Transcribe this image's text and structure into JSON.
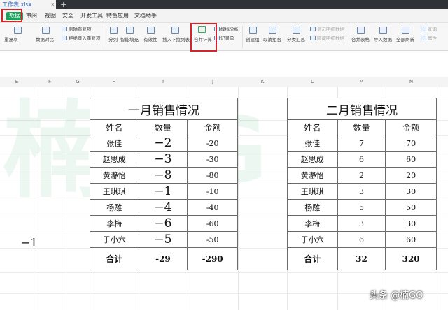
{
  "app": {
    "file_tab": "工作表.xlsx",
    "tab_close": "×",
    "add_tab": "+"
  },
  "menu": [
    "数据",
    "审阅",
    "视图",
    "安全",
    "开发工具",
    "特色应用",
    "文档助手"
  ],
  "menu_active_index": 0,
  "ribbon": {
    "dup_items": "重复项",
    "data_compare": "数据对比",
    "delete_dup": "删除重复项",
    "reject_dup": "拒绝录入重复项",
    "split": "分列",
    "smart_fill": "智能填充",
    "validity": "有效性",
    "insert_dropdown": "插入下拉列表",
    "consolidate": "合并计算",
    "simulate": "模拟分析",
    "record_sheet": "记录单",
    "group": "创建组",
    "ungroup": "取消组合",
    "subtotal": "分类汇总",
    "show_detail": "显示明细数据",
    "hide_detail": "隐藏明细数据",
    "merge_sheets": "合并表格",
    "import_data": "导入数据",
    "refresh_all": "全部刷新",
    "query": "查询",
    "properties": "属性"
  },
  "columns": [
    "E",
    "F",
    "G",
    "H",
    "I",
    "J",
    "K",
    "L",
    "M",
    "N"
  ],
  "table_jan": {
    "title": "一月销售情况",
    "headers": [
      "姓名",
      "数量",
      "金额"
    ],
    "rows": [
      [
        "张佳",
        "−2",
        "-20"
      ],
      [
        "赵思成",
        "−3",
        "-30"
      ],
      [
        "黄瀞怡",
        "−8",
        "-80"
      ],
      [
        "王琪琪",
        "−1",
        "-10"
      ],
      [
        "杨雕",
        "−4",
        "-40"
      ],
      [
        "李梅",
        "−6",
        "-60"
      ],
      [
        "于小六",
        "−5",
        "-50"
      ]
    ],
    "total": [
      "合计",
      "-29",
      "-290"
    ]
  },
  "table_feb": {
    "title": "二月销售情况",
    "headers": [
      "姓名",
      "数量",
      "金额"
    ],
    "rows": [
      [
        "张佳",
        "7",
        "70"
      ],
      [
        "赵思成",
        "6",
        "60"
      ],
      [
        "黄瀞怡",
        "2",
        "20"
      ],
      [
        "王琪琪",
        "3",
        "30"
      ],
      [
        "杨雕",
        "5",
        "50"
      ],
      [
        "李梅",
        "3",
        "30"
      ],
      [
        "于小六",
        "6",
        "60"
      ]
    ],
    "total": [
      "合计",
      "32",
      "320"
    ]
  },
  "stray_cell": "−1",
  "watermark": [
    "楠",
    "G",
    "O"
  ],
  "brand": "头条 @楠GO",
  "colors": {
    "accent_green": "#17a55a",
    "highlight_red": "#d4232a"
  }
}
